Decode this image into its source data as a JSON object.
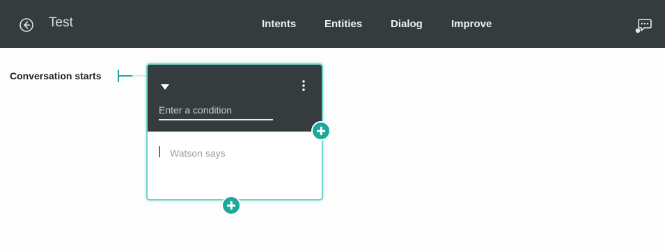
{
  "header": {
    "title": "Test",
    "tabs": [
      {
        "label": "Intents"
      },
      {
        "label": "Entities"
      },
      {
        "label": "Dialog"
      },
      {
        "label": "Improve"
      }
    ],
    "icons": {
      "back": "arrow-left-circle-icon",
      "chat": "chat-bubble-icon"
    }
  },
  "canvas": {
    "start_label": "Conversation starts",
    "node": {
      "condition_placeholder": "Enter a condition",
      "response_placeholder": "Watson says",
      "icons": {
        "toggle": "caret-down-icon",
        "menu": "vertical-ellipsis-icon",
        "add_child": "plus-icon",
        "add_sibling": "plus-icon"
      }
    }
  },
  "colors": {
    "header_bg": "#353c3e",
    "accent": "#1fa899",
    "node_border": "#72d3c8",
    "response_marker": "#c2409a"
  }
}
